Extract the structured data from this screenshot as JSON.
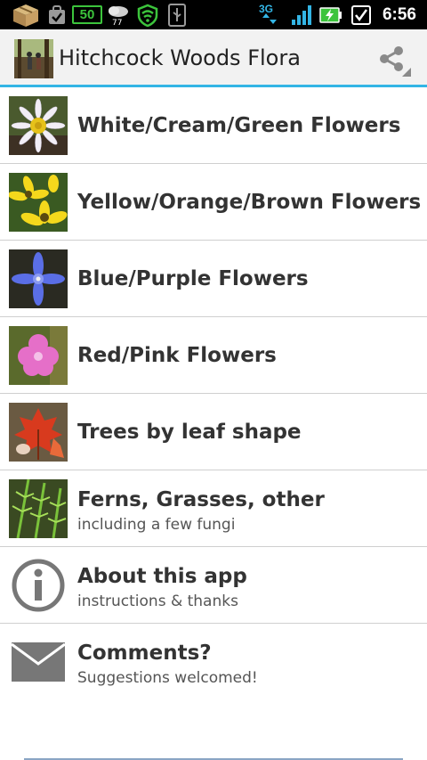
{
  "status_bar": {
    "battery_badge": "50",
    "network_type": "3G",
    "time": "6:56",
    "icons": [
      "package-icon",
      "task-check-icon",
      "battery-level-icon",
      "weather-snow-icon",
      "wifi-shield-icon",
      "usb-icon",
      "network-3g-icon",
      "signal-bars-icon",
      "battery-charging-icon",
      "checkbox-notification-icon"
    ],
    "accent_color": "#33b5e5"
  },
  "action_bar": {
    "title": "Hitchcock Woods Flora",
    "share_icon": "share-icon",
    "divider_color": "#33b5e5"
  },
  "menu": {
    "items": [
      {
        "title": "White/Cream/Green Flowers",
        "subtitle": "",
        "thumbnail": "white-daisy-thumbnail"
      },
      {
        "title": "Yellow/Orange/Brown Flowers",
        "subtitle": "",
        "thumbnail": "yellow-flower-thumbnail"
      },
      {
        "title": "Blue/Purple Flowers",
        "subtitle": "",
        "thumbnail": "blue-flower-thumbnail"
      },
      {
        "title": "Red/Pink Flowers",
        "subtitle": "",
        "thumbnail": "pink-flower-thumbnail"
      },
      {
        "title": "Trees by leaf shape",
        "subtitle": "",
        "thumbnail": "red-maple-leaf-thumbnail"
      },
      {
        "title": "Ferns, Grasses, other",
        "subtitle": "including a few fungi",
        "thumbnail": "fern-thumbnail"
      },
      {
        "title": "About this app",
        "subtitle": "instructions & thanks",
        "icon": "info-icon"
      },
      {
        "title": "Comments?",
        "subtitle": "Suggestions welcomed!",
        "icon": "envelope-icon"
      }
    ]
  }
}
